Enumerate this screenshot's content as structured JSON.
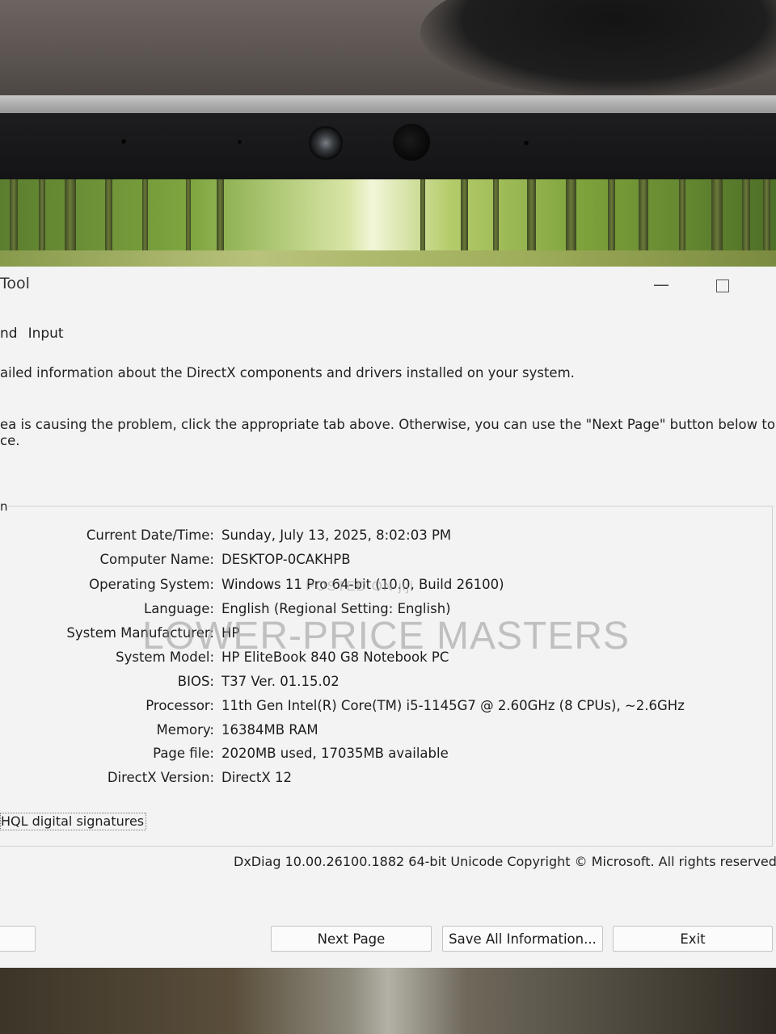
{
  "window": {
    "title": "Tool",
    "tabs": [
      "nd",
      "Input"
    ]
  },
  "description": {
    "line1": "ailed information about the DirectX components and drivers installed on your system.",
    "line2": "ea is causing the problem, click the appropriate tab above.  Otherwise, you can use the \"Next Page\" button below to visit",
    "line3": "ce."
  },
  "system_info": {
    "group_label": "n",
    "rows": [
      {
        "label": "Current Date/Time:",
        "value": "Sunday, July 13, 2025, 8:02:03 PM"
      },
      {
        "label": "Computer Name:",
        "value": "DESKTOP-0CAKHPB"
      },
      {
        "label": "Operating System:",
        "value": "Windows 11 Pro 64-bit (10.0, Build 26100)"
      },
      {
        "label": "Language:",
        "value": "English (Regional Setting: English)"
      },
      {
        "label": "System Manufacturer:",
        "value": "HP"
      },
      {
        "label": "System Model:",
        "value": "HP EliteBook 840 G8 Notebook PC"
      },
      {
        "label": "BIOS:",
        "value": "T37 Ver. 01.15.02"
      },
      {
        "label": "Processor:",
        "value": "11th Gen Intel(R) Core(TM) i5-1145G7 @ 2.60GHz (8 CPUs), ~2.6GHz"
      },
      {
        "label": "Memory:",
        "value": "16384MB RAM"
      },
      {
        "label": "Page file:",
        "value": "2020MB used, 17035MB available"
      },
      {
        "label": "DirectX Version:",
        "value": "DirectX 12"
      }
    ]
  },
  "whql_checkbox_label": "HQL digital signatures",
  "footer": "DxDiag 10.00.26100.1882 64-bit Unicode  Copyright © Microsoft. All rights reserved.",
  "buttons": {
    "help": "",
    "next_page": "Next Page",
    "save_all": "Save All Information...",
    "exit": "Exit"
  },
  "watermark": {
    "posted_on": "POSTED ON jiji",
    "seller": "LOWER-PRICE MASTERS"
  }
}
